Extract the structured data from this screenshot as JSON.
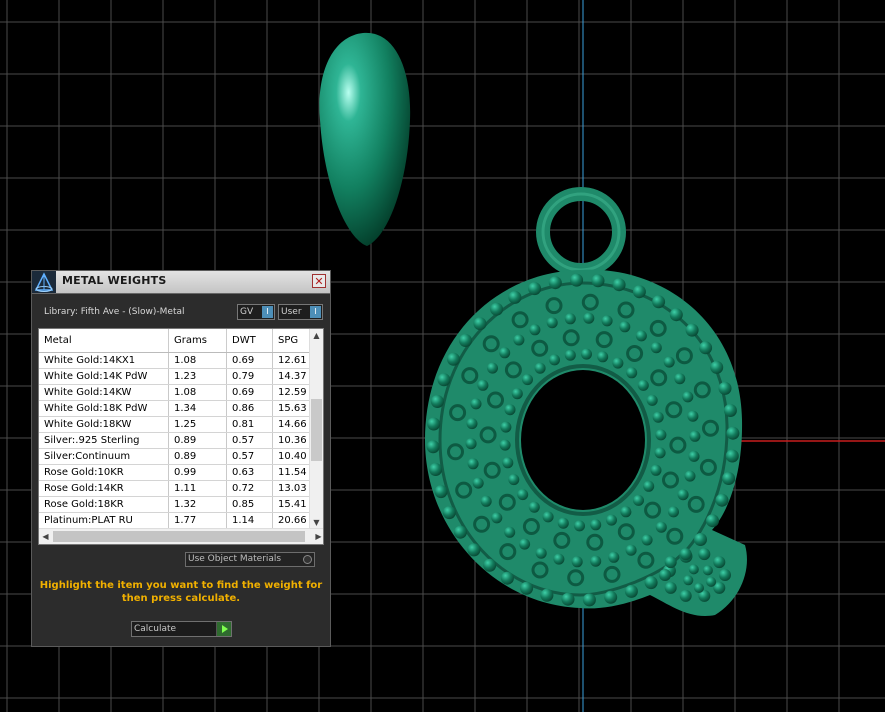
{
  "viewport": {
    "background": "#000000",
    "grid_color": "#4a4a4a",
    "axis_y_color": "#3aa0dc",
    "axis_x_color": "#d02020",
    "model_color": "#1f8a6a"
  },
  "panel": {
    "title": "METAL WEIGHTS",
    "close_glyph": "✕",
    "library": "Library: Fifth Ave - (Slow)-Metal",
    "gv_label": "GV",
    "user_label": "User",
    "toggle_glyph": "I",
    "columns": [
      "Metal",
      "Grams",
      "DWT",
      "SPG"
    ],
    "rows": [
      {
        "metal": "White Gold:14KX1",
        "grams": "1.08",
        "dwt": "0.69",
        "spg": "12.61"
      },
      {
        "metal": "White Gold:14K PdW",
        "grams": "1.23",
        "dwt": "0.79",
        "spg": "14.37"
      },
      {
        "metal": "White Gold:14KW",
        "grams": "1.08",
        "dwt": "0.69",
        "spg": "12.59"
      },
      {
        "metal": "White Gold:18K PdW",
        "grams": "1.34",
        "dwt": "0.86",
        "spg": "15.63"
      },
      {
        "metal": "White Gold:18KW",
        "grams": "1.25",
        "dwt": "0.81",
        "spg": "14.66"
      },
      {
        "metal": "Silver:.925 Sterling",
        "grams": "0.89",
        "dwt": "0.57",
        "spg": "10.36"
      },
      {
        "metal": "Silver:Continuum",
        "grams": "0.89",
        "dwt": "0.57",
        "spg": "10.40"
      },
      {
        "metal": "Rose Gold:10KR",
        "grams": "0.99",
        "dwt": "0.63",
        "spg": "11.54"
      },
      {
        "metal": "Rose Gold:14KR",
        "grams": "1.11",
        "dwt": "0.72",
        "spg": "13.03"
      },
      {
        "metal": "Rose Gold:18KR",
        "grams": "1.32",
        "dwt": "0.85",
        "spg": "15.41"
      },
      {
        "metal": "Platinum:PLAT RU",
        "grams": "1.77",
        "dwt": "1.14",
        "spg": "20.66"
      }
    ],
    "use_object_materials": "Use Object Materials",
    "instruction": "Highlight the item you want to find the weight for then press calculate.",
    "calculate_label": "Calculate",
    "accent_color": "#f0b000"
  }
}
